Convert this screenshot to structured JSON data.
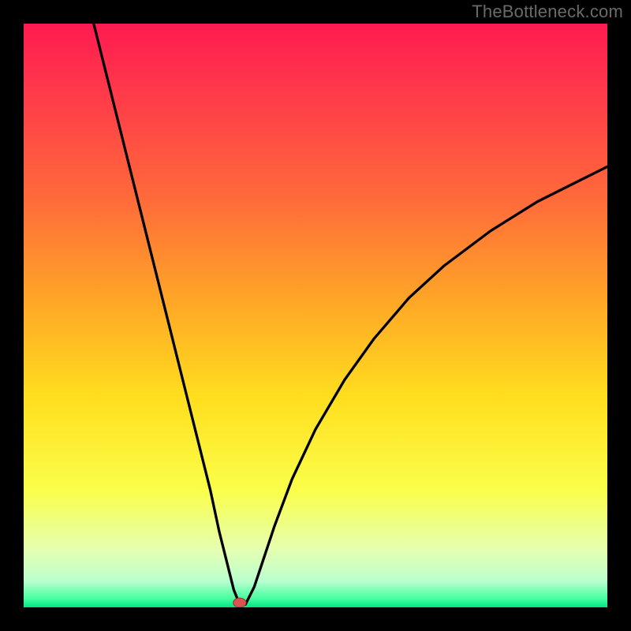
{
  "watermark": "TheBottleneck.com",
  "chart_data": {
    "type": "line",
    "title": "",
    "xlabel": "",
    "ylabel": "",
    "xlim": [
      0,
      100
    ],
    "ylim": [
      0,
      100
    ],
    "marker": {
      "x": 37,
      "y": 0
    },
    "background": {
      "stops": [
        {
          "offset": 0.0,
          "color": "#ff1a4f"
        },
        {
          "offset": 0.12,
          "color": "#ff3a4a"
        },
        {
          "offset": 0.3,
          "color": "#ff6a3a"
        },
        {
          "offset": 0.48,
          "color": "#ffa826"
        },
        {
          "offset": 0.64,
          "color": "#ffde1e"
        },
        {
          "offset": 0.8,
          "color": "#faff4a"
        },
        {
          "offset": 0.9,
          "color": "#e6ffb0"
        },
        {
          "offset": 0.955,
          "color": "#baffcf"
        },
        {
          "offset": 0.985,
          "color": "#46ffa0"
        },
        {
          "offset": 1.0,
          "color": "#00e383"
        }
      ]
    },
    "curve_left": [
      {
        "x": 12.0,
        "y": 100.0
      },
      {
        "x": 14.0,
        "y": 92.0
      },
      {
        "x": 16.0,
        "y": 84.0
      },
      {
        "x": 18.0,
        "y": 76.0
      },
      {
        "x": 20.0,
        "y": 68.0
      },
      {
        "x": 22.0,
        "y": 60.0
      },
      {
        "x": 24.0,
        "y": 52.0
      },
      {
        "x": 26.0,
        "y": 44.0
      },
      {
        "x": 28.0,
        "y": 36.0
      },
      {
        "x": 30.0,
        "y": 28.0
      },
      {
        "x": 32.0,
        "y": 20.0
      },
      {
        "x": 33.5,
        "y": 13.0
      },
      {
        "x": 35.0,
        "y": 7.0
      },
      {
        "x": 36.0,
        "y": 3.0
      },
      {
        "x": 37.0,
        "y": 0.5
      }
    ],
    "curve_right": [
      {
        "x": 38.0,
        "y": 0.5
      },
      {
        "x": 39.5,
        "y": 3.5
      },
      {
        "x": 41.0,
        "y": 8.0
      },
      {
        "x": 43.0,
        "y": 14.0
      },
      {
        "x": 46.0,
        "y": 22.0
      },
      {
        "x": 50.0,
        "y": 30.5
      },
      {
        "x": 55.0,
        "y": 39.0
      },
      {
        "x": 60.0,
        "y": 46.0
      },
      {
        "x": 66.0,
        "y": 53.0
      },
      {
        "x": 72.0,
        "y": 58.5
      },
      {
        "x": 80.0,
        "y": 64.5
      },
      {
        "x": 88.0,
        "y": 69.5
      },
      {
        "x": 95.0,
        "y": 73.0
      },
      {
        "x": 100.0,
        "y": 75.5
      }
    ]
  }
}
